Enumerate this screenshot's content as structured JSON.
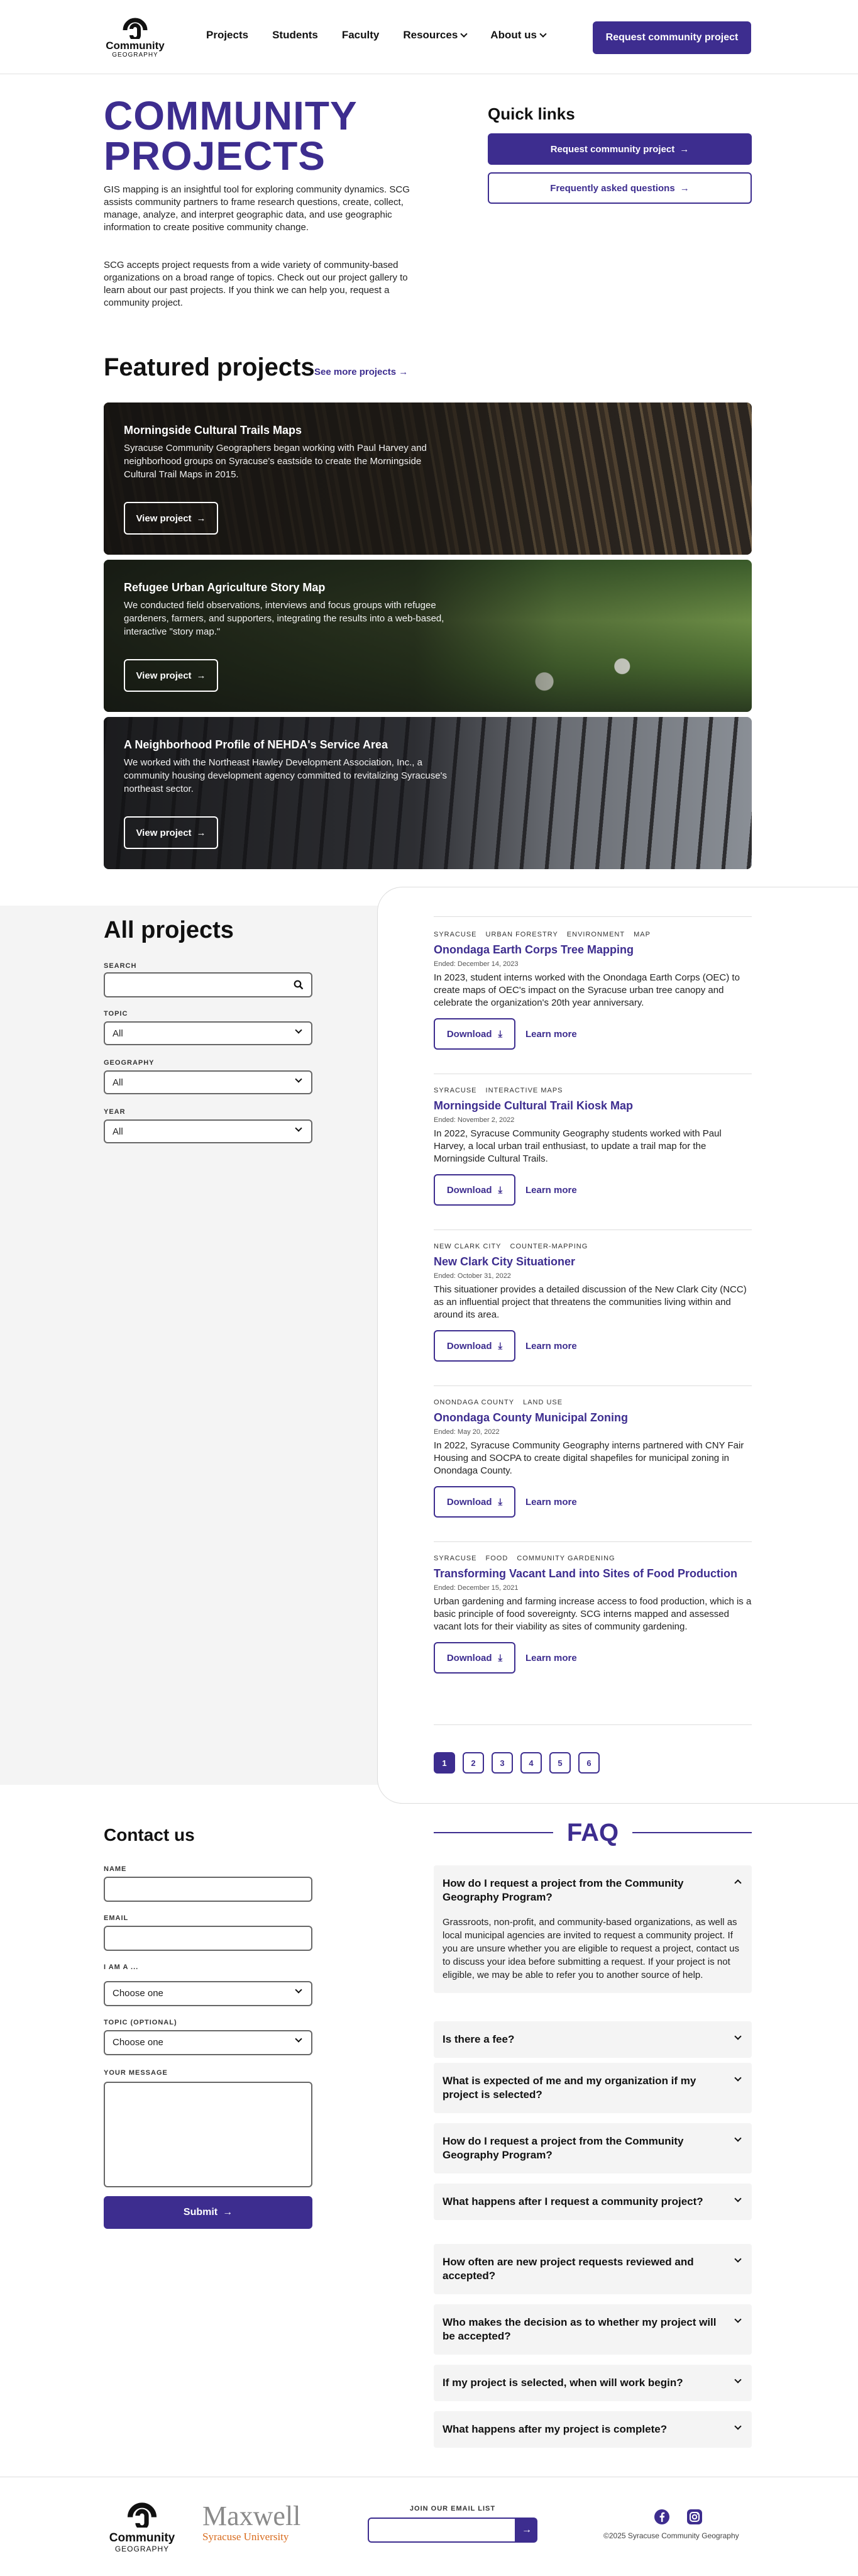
{
  "header": {
    "logo": {
      "line1": "Community",
      "line2": "GEOGRAPHY"
    },
    "nav": [
      {
        "label": "Projects",
        "dropdown": false
      },
      {
        "label": "Students",
        "dropdown": false
      },
      {
        "label": "Faculty",
        "dropdown": false
      },
      {
        "label": "Resources",
        "dropdown": true
      },
      {
        "label": "About us",
        "dropdown": true
      }
    ],
    "cta": "Request community project"
  },
  "intro": {
    "title_line1": "COMMUNITY",
    "title_line2": "PROJECTS",
    "p1": "GIS mapping is an insightful tool for exploring community dynamics. SCG assists community partners to frame research questions, create, collect, manage, analyze, and interpret geographic data, and use geographic information to create positive community change.",
    "p2": "SCG accepts project requests from a wide variety of community-based organizations on a broad range of topics. Check out our project gallery to learn about our past projects. If you think we can help you, request a community project."
  },
  "quick_links": {
    "title": "Quick links",
    "request": "Request community project",
    "faq": "Frequently asked questions"
  },
  "featured": {
    "title": "Featured projects",
    "see_more": "See more projects",
    "cards": [
      {
        "title": "Morningside Cultural Trails Maps",
        "desc": "Syracuse Community Geographers began working with Paul Harvey and neighborhood groups on Syracuse's eastside to create the Morningside Cultural Trail Maps in 2015.",
        "button": "View project"
      },
      {
        "title": "Refugee Urban Agriculture Story Map",
        "desc": "We conducted field observations, interviews and focus groups with refugee gardeners, farmers, and supporters, integrating the results into a web-based, interactive \"story map.\"",
        "button": "View project"
      },
      {
        "title": "A Neighborhood Profile of NEHDA's Service Area",
        "desc": "We worked with the Northeast Hawley Development Association, Inc., a community housing development agency committed to revitalizing Syracuse's northeast sector.",
        "button": "View project"
      }
    ]
  },
  "all_projects": {
    "title": "All projects",
    "search_label": "SEARCH",
    "search_placeholder": "",
    "topic_label": "TOPIC",
    "topic_value": "All",
    "geography_label": "GEOGRAPHY",
    "geography_value": "All",
    "year_label": "YEAR",
    "year_value": "All",
    "download_label": "Download",
    "learn_label": "Learn more",
    "projects": [
      {
        "tags": [
          "SYRACUSE",
          "URBAN FORESTRY",
          "ENVIRONMENT",
          "MAP"
        ],
        "title": "Onondaga Earth Corps Tree Mapping",
        "ended": "Ended: December 14, 2023",
        "desc": "In 2023, student interns worked with the Onondaga Earth Corps (OEC) to create maps of OEC's impact on the Syracuse urban tree canopy and celebrate the organization's 20th year anniversary."
      },
      {
        "tags": [
          "SYRACUSE",
          "INTERACTIVE MAPS"
        ],
        "title": "Morningside Cultural Trail Kiosk Map",
        "ended": "Ended: November 2, 2022",
        "desc": "In 2022, Syracuse Community Geography students worked with Paul Harvey, a local urban trail enthusiast, to update a trail map for the Morningside Cultural Trails."
      },
      {
        "tags": [
          "NEW CLARK CITY",
          "COUNTER-MAPPING"
        ],
        "title": "New Clark City Situationer",
        "ended": "Ended: October 31, 2022",
        "desc": "This situationer provides a detailed discussion of the New Clark City (NCC) as an influential project that threatens the communities living within and around its area."
      },
      {
        "tags": [
          "ONONDAGA COUNTY",
          "LAND USE"
        ],
        "title": "Onondaga County Municipal Zoning",
        "ended": "Ended: May 20, 2022",
        "desc": "In 2022, Syracuse Community Geography interns partnered with CNY Fair Housing and SOCPA to create digital shapefiles for municipal zoning in Onondaga County."
      },
      {
        "tags": [
          "SYRACUSE",
          "FOOD",
          "COMMUNITY GARDENING"
        ],
        "title": "Transforming Vacant Land into Sites of Food Production",
        "ended": "Ended: December 15, 2021",
        "desc": "Urban gardening and farming increase access to food production, which is a basic principle of food sovereignty. SCG interns mapped and assessed vacant lots for their viability as sites of community gardening."
      }
    ],
    "pages": [
      "1",
      "2",
      "3",
      "4",
      "5",
      "6"
    ]
  },
  "contact": {
    "title": "Contact us",
    "name_label": "NAME",
    "email_label": "EMAIL",
    "iam_label": "I AM A ...",
    "iam_value": "Choose one",
    "topic_label": "TOPIC (OPTIONAL)",
    "topic_value": "Choose one",
    "message_label": "YOUR MESSAGE",
    "submit": "Submit"
  },
  "faq": {
    "title": "FAQ",
    "items": [
      {
        "q": "How do I request a project from the Community Geography Program?",
        "a": "Grassroots, non-profit, and community-based organizations, as well as local municipal agencies are invited to request a community project. If you are unsure whether you are eligible to request a project, contact us to discuss your idea before submitting a request. If your project is not eligible, we may be able to refer you to another source of help."
      },
      {
        "q": "Is there a fee?"
      },
      {
        "q": "What is expected of me and my organization if my project is selected?"
      },
      {
        "q": "How do I request a project from the Community Geography Program?"
      },
      {
        "q": "What happens after I request a community project?"
      },
      {
        "q": "How often are new project requests reviewed and accepted?"
      },
      {
        "q": "Who makes the decision as to whether my project will be accepted?"
      },
      {
        "q": "If my project is selected, when will work begin?"
      },
      {
        "q": "What happens after my project is complete?"
      }
    ]
  },
  "footer": {
    "logo": {
      "line1": "Community",
      "line2": "GEOGRAPHY"
    },
    "maxwell": "Maxwell",
    "university": "Syracuse University",
    "email_label": "JOIN OUR EMAIL LIST",
    "copyright": "©2025 Syracuse Community Geography",
    "social": [
      "facebook-icon",
      "instagram-icon"
    ],
    "brand_color": "#3d2d8f"
  }
}
